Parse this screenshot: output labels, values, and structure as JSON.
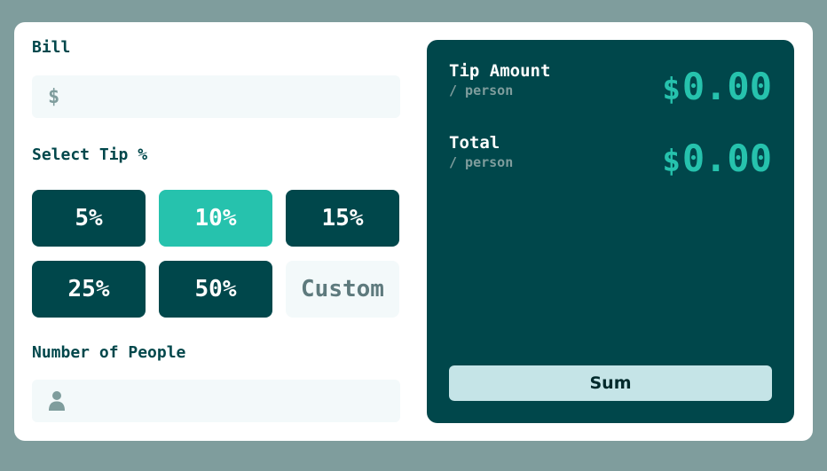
{
  "bill": {
    "label": "Bill",
    "currency": "$",
    "value": ""
  },
  "tip": {
    "label": "Select Tip %",
    "options": [
      "5%",
      "10%",
      "15%",
      "25%",
      "50%"
    ],
    "selected": "10%",
    "custom_placeholder": "Custom"
  },
  "people": {
    "label": "Number of People",
    "value": ""
  },
  "results": {
    "tip_amount": {
      "title": "Tip Amount",
      "sub": "/ person",
      "currency": "$",
      "value": "0.00"
    },
    "total": {
      "title": "Total",
      "sub": "/ person",
      "currency": "$",
      "value": "0.00"
    },
    "sum_label": "Sum"
  },
  "colors": {
    "background": "#7f9d9d",
    "dark_cyan": "#00474b",
    "accent": "#26c2ad",
    "light_field": "#f3f9fa",
    "sum_button": "#c5e4e7"
  }
}
